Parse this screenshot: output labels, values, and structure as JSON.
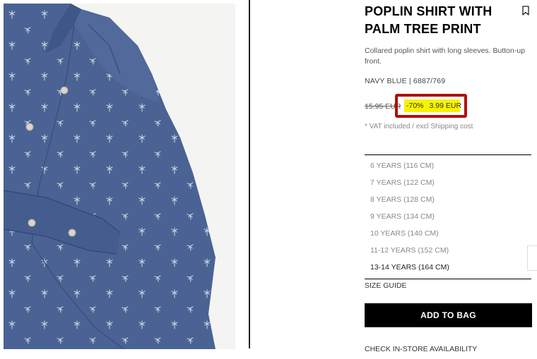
{
  "product": {
    "title": "POPLIN SHIRT WITH PALM TREE PRINT",
    "description": "Collared poplin shirt with long sleeves. Button-up front.",
    "color_ref": "NAVY BLUE | 6887/769",
    "old_price": "15.95 EUR",
    "discount": "-70%",
    "sale_price": "3.99 EUR",
    "vat_note": "* VAT included / excl Shipping cost"
  },
  "sizes": [
    "6 YEARS (116 CM)",
    "7 YEARS (122 CM)",
    "8 YEARS (128 CM)",
    "9 YEARS (134 CM)",
    "10 YEARS (140 CM)",
    "11-12 YEARS (152 CM)",
    "13-14 YEARS (164 CM)"
  ],
  "actions": {
    "size_guide": "SIZE GUIDE",
    "add_to_bag": "ADD TO BAG",
    "check_store": "CHECK IN-STORE AVAILABILITY"
  },
  "colors": {
    "shirt": "#4a6394",
    "highlight": "#f6f200",
    "highlight_border": "#b10f0f",
    "button_bg": "#000000"
  },
  "icons": {
    "bookmark": "bookmark-icon"
  }
}
